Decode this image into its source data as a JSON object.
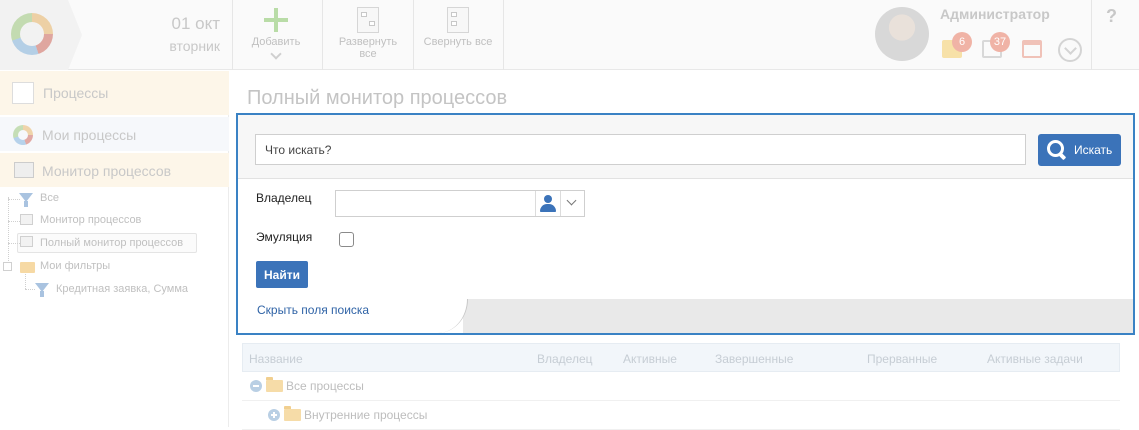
{
  "header": {
    "date_day": "01 окт",
    "date_weekday": "вторник",
    "toolbar": {
      "add_label": "Добавить",
      "expand_all_label": "Развернуть все",
      "collapse_all_label": "Свернуть все"
    },
    "user_name": "Администратор",
    "badges": {
      "messages": "6",
      "tasks": "37"
    },
    "help_label": "?"
  },
  "sidebar": {
    "section_title": "Процессы",
    "items": [
      {
        "label": "Мои процессы"
      },
      {
        "label": "Монитор процессов"
      }
    ],
    "tree": {
      "all": "Все",
      "process_monitor": "Монитор процессов",
      "full_process_monitor": "Полный монитор процессов",
      "my_filters": "Мои фильтры",
      "filter_credit": "Кредитная заявка, Сумма"
    }
  },
  "main": {
    "page_title": "Полный монитор процессов",
    "search": {
      "placeholder": "Что искать?",
      "button_label": "Искать",
      "owner_label": "Владелец",
      "emulation_label": "Эмуляция",
      "find_button_label": "Найти",
      "hide_fields_link": "Скрыть поля поиска"
    },
    "table": {
      "columns": [
        "Название",
        "Владелец",
        "Активные",
        "Завершенные",
        "Прерванные",
        "Активные задачи"
      ],
      "rows": [
        {
          "label": "Все процессы"
        },
        {
          "label": "Внутренние процессы"
        }
      ]
    }
  }
}
